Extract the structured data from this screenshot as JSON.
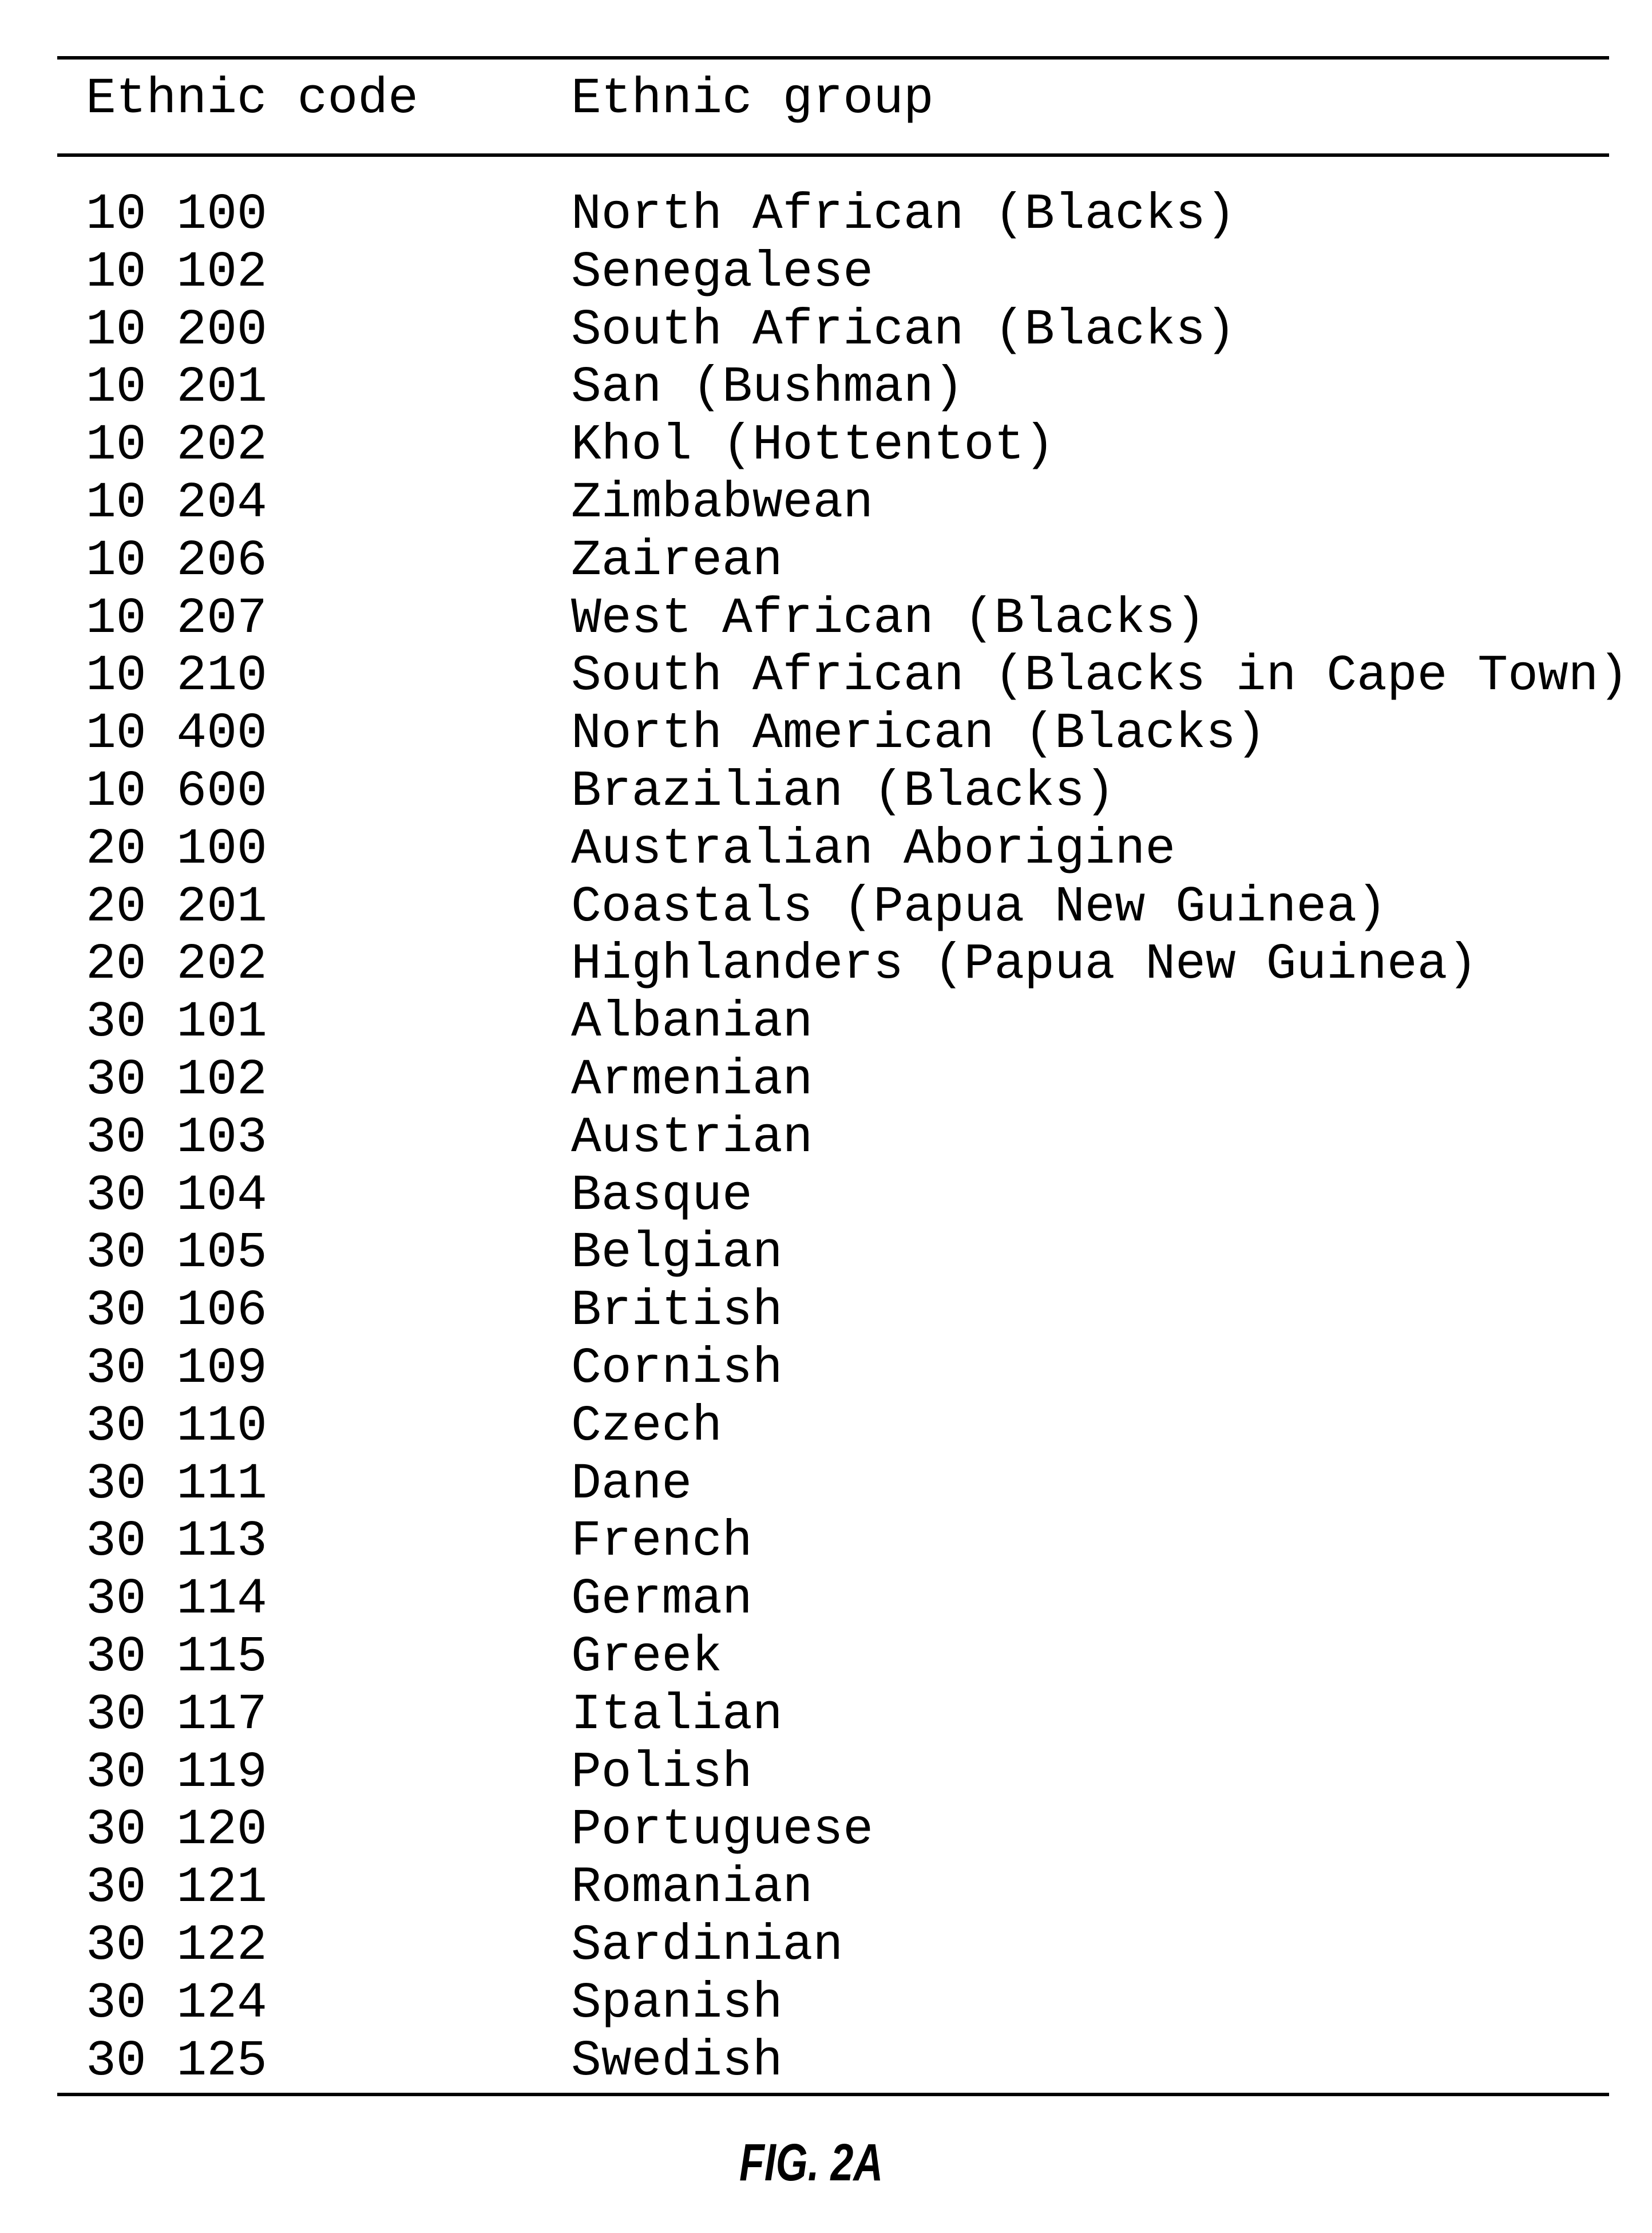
{
  "table": {
    "headers": {
      "code": "Ethnic code",
      "group": "Ethnic group"
    },
    "rows": [
      {
        "code": "10 100",
        "group": "North African (Blacks)"
      },
      {
        "code": "10 102",
        "group": "Senegalese"
      },
      {
        "code": "10 200",
        "group": "South African (Blacks)"
      },
      {
        "code": "10 201",
        "group": "San (Bushman)"
      },
      {
        "code": "10 202",
        "group": "Khol (Hottentot)"
      },
      {
        "code": "10 204",
        "group": "Zimbabwean"
      },
      {
        "code": "10 206",
        "group": "Zairean"
      },
      {
        "code": "10 207",
        "group": "West African (Blacks)"
      },
      {
        "code": "10 210",
        "group": "South African (Blacks in Cape Town)"
      },
      {
        "code": "10 400",
        "group": "North American (Blacks)"
      },
      {
        "code": "10 600",
        "group": "Brazilian (Blacks)"
      },
      {
        "code": "20 100",
        "group": "Australian Aborigine"
      },
      {
        "code": "20 201",
        "group": "Coastals (Papua New Guinea)"
      },
      {
        "code": "20 202",
        "group": "Highlanders (Papua New Guinea)"
      },
      {
        "code": "30 101",
        "group": "Albanian"
      },
      {
        "code": "30 102",
        "group": "Armenian"
      },
      {
        "code": "30 103",
        "group": "Austrian"
      },
      {
        "code": "30 104",
        "group": "Basque"
      },
      {
        "code": "30 105",
        "group": "Belgian"
      },
      {
        "code": "30 106",
        "group": "British"
      },
      {
        "code": "30 109",
        "group": "Cornish"
      },
      {
        "code": "30 110",
        "group": "Czech"
      },
      {
        "code": "30 111",
        "group": "Dane"
      },
      {
        "code": "30 113",
        "group": "French"
      },
      {
        "code": "30 114",
        "group": "German"
      },
      {
        "code": "30 115",
        "group": "Greek"
      },
      {
        "code": "30 117",
        "group": "Italian"
      },
      {
        "code": "30 119",
        "group": "Polish"
      },
      {
        "code": "30 120",
        "group": "Portuguese"
      },
      {
        "code": "30 121",
        "group": "Romanian"
      },
      {
        "code": "30 122",
        "group": "Sardinian"
      },
      {
        "code": "30 124",
        "group": "Spanish"
      },
      {
        "code": "30 125",
        "group": "Swedish"
      }
    ]
  },
  "figure_label": "FIG. 2A"
}
